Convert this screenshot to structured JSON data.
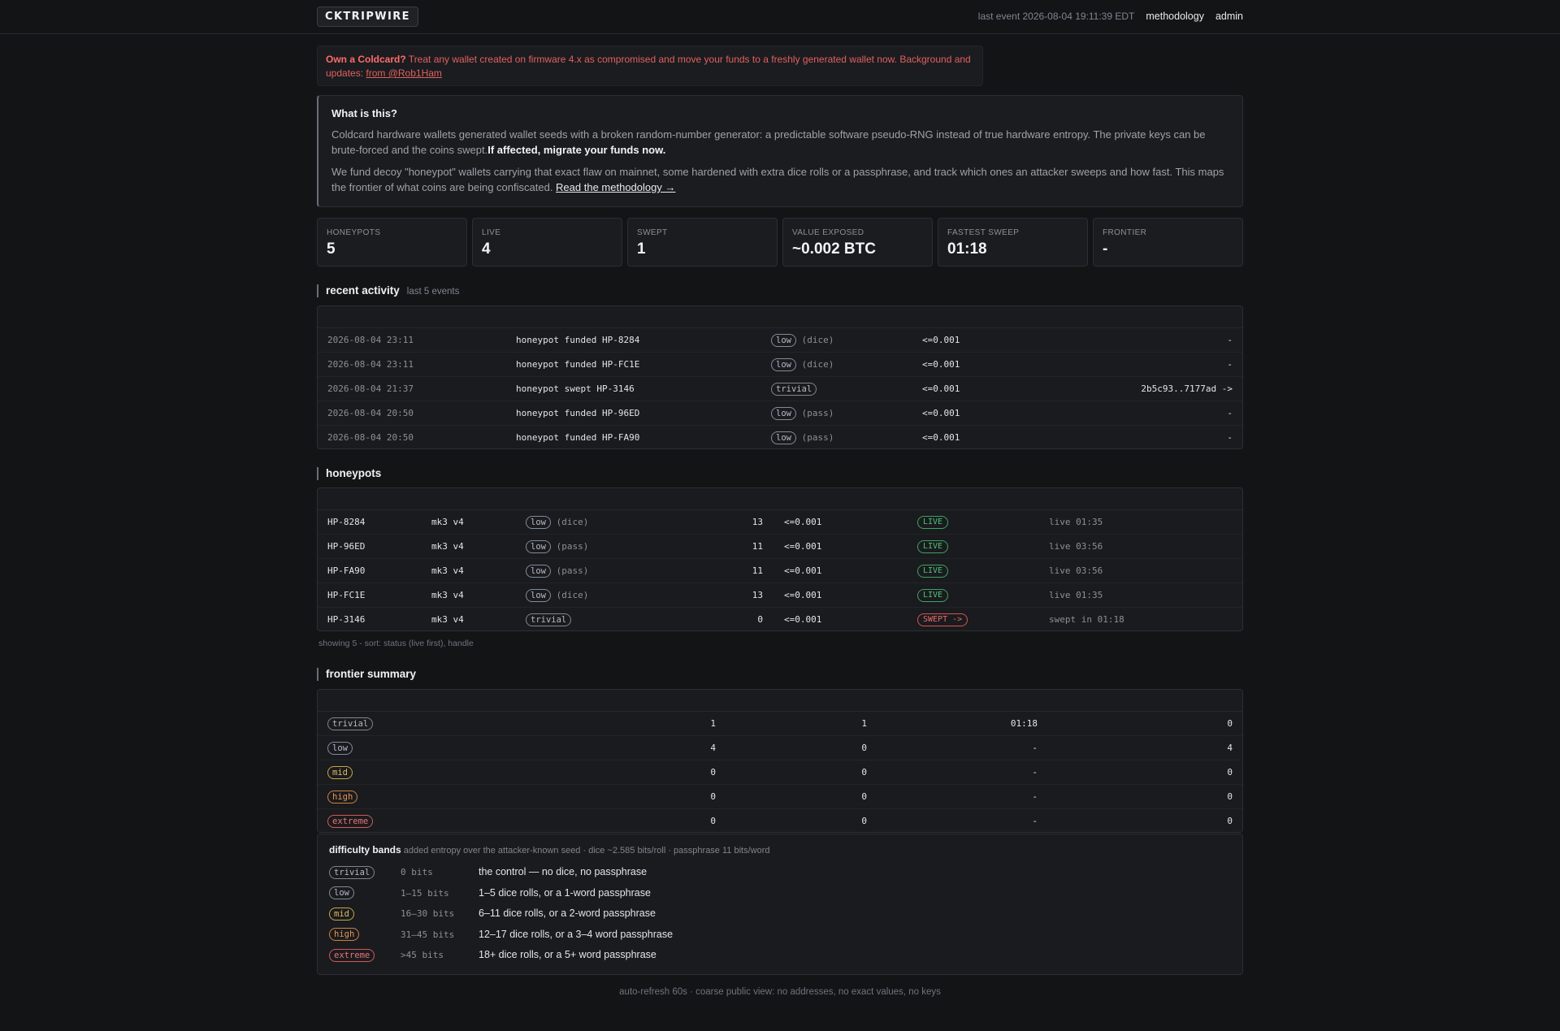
{
  "header": {
    "logo": "CKTRIPWIRE",
    "last_event": "last event 2026-08-04 19:11:39 EDT",
    "nav": [
      "methodology",
      "admin"
    ]
  },
  "alert": {
    "strong": "Own a Coldcard?",
    "text": " Treat any wallet created on firmware 4.x as compromised and move your funds to a freshly generated wallet now. Background and updates: ",
    "link": "from @Rob1Ham"
  },
  "about": {
    "title": "What is this?",
    "p1": "Coldcard hardware wallets generated wallet seeds with a broken random-number generator: a predictable software pseudo-RNG instead of true hardware entropy. The private keys can be brute-forced and the coins swept.",
    "p1_bold": "If affected, migrate your funds now.",
    "p2": "We fund decoy \"honeypot\" wallets carrying that exact flaw on mainnet, some hardened with extra dice rolls or a passphrase, and track which ones an attacker sweeps and how fast. This maps the frontier of what coins are being confiscated. ",
    "p2_link": "Read the methodology →"
  },
  "stats": [
    {
      "label": "HONEYPOTS",
      "value": "5"
    },
    {
      "label": "LIVE",
      "value": "4"
    },
    {
      "label": "SWEPT",
      "value": "1"
    },
    {
      "label": "VALUE EXPOSED",
      "value": "~0.002 BTC"
    },
    {
      "label": "FASTEST SWEEP",
      "value": "01:18"
    },
    {
      "label": "FRONTIER",
      "value": "-"
    }
  ],
  "activity": {
    "title": "recent activity",
    "subtitle": "last 5 events",
    "rows": [
      {
        "time": "2026-08-04 23:11",
        "event": "honeypot funded HP-8284",
        "band": "low",
        "hardening": "(dice)",
        "value": "<=0.001",
        "tx": "-"
      },
      {
        "time": "2026-08-04 23:11",
        "event": "honeypot funded HP-FC1E",
        "band": "low",
        "hardening": "(dice)",
        "value": "<=0.001",
        "tx": "-"
      },
      {
        "time": "2026-08-04 21:37",
        "event": "honeypot swept HP-3146",
        "band": "trivial",
        "hardening": "",
        "value": "<=0.001",
        "tx": "2b5c93..7177ad ->"
      },
      {
        "time": "2026-08-04 20:50",
        "event": "honeypot funded HP-96ED",
        "band": "low",
        "hardening": "(pass)",
        "value": "<=0.001",
        "tx": "-"
      },
      {
        "time": "2026-08-04 20:50",
        "event": "honeypot funded HP-FA90",
        "band": "low",
        "hardening": "(pass)",
        "value": "<=0.001",
        "tx": "-"
      }
    ]
  },
  "honeypots": {
    "title": "honeypots",
    "rows": [
      {
        "handle": "HP-8284",
        "device": "mk3 v4",
        "band": "low",
        "hardening": "(dice)",
        "bits": "13",
        "value": "<=0.001",
        "status": "LIVE",
        "kind": "live",
        "age": "live 01:35"
      },
      {
        "handle": "HP-96ED",
        "device": "mk3 v4",
        "band": "low",
        "hardening": "(pass)",
        "bits": "11",
        "value": "<=0.001",
        "status": "LIVE",
        "kind": "live",
        "age": "live 03:56"
      },
      {
        "handle": "HP-FA90",
        "device": "mk3 v4",
        "band": "low",
        "hardening": "(pass)",
        "bits": "11",
        "value": "<=0.001",
        "status": "LIVE",
        "kind": "live",
        "age": "live 03:56"
      },
      {
        "handle": "HP-FC1E",
        "device": "mk3 v4",
        "band": "low",
        "hardening": "(dice)",
        "bits": "13",
        "value": "<=0.001",
        "status": "LIVE",
        "kind": "live",
        "age": "live 01:35"
      },
      {
        "handle": "HP-3146",
        "device": "mk3 v4",
        "band": "trivial",
        "hardening": "",
        "bits": "0",
        "value": "<=0.001",
        "status": "SWEPT ->",
        "kind": "swept",
        "age": "swept in 01:18"
      }
    ],
    "caption": "showing 5 - sort: status (live first), handle"
  },
  "frontier": {
    "title": "frontier summary",
    "rows": [
      {
        "band": "trivial",
        "total": "1",
        "swept": "1",
        "fastest": "01:18",
        "live": "0"
      },
      {
        "band": "low",
        "total": "4",
        "swept": "0",
        "fastest": "-",
        "live": "4"
      },
      {
        "band": "mid",
        "total": "0",
        "swept": "0",
        "fastest": "-",
        "live": "0"
      },
      {
        "band": "high",
        "total": "0",
        "swept": "0",
        "fastest": "-",
        "live": "0"
      },
      {
        "band": "extreme",
        "total": "0",
        "swept": "0",
        "fastest": "-",
        "live": "0"
      }
    ]
  },
  "bands": {
    "title": "difficulty bands",
    "subtitle": "added entropy over the attacker-known seed · dice ~2.585 bits/roll · passphrase 11 bits/word",
    "rows": [
      {
        "band": "trivial",
        "bits": "0 bits",
        "desc": "the control — no dice, no passphrase"
      },
      {
        "band": "low",
        "bits": "1–15 bits",
        "desc": "1–5 dice rolls, or a 1-word passphrase"
      },
      {
        "band": "mid",
        "bits": "16–30 bits",
        "desc": "6–11 dice rolls, or a 2-word passphrase"
      },
      {
        "band": "high",
        "bits": "31–45 bits",
        "desc": "12–17 dice rolls, or a 3–4 word passphrase"
      },
      {
        "band": "extreme",
        "bits": ">45 bits",
        "desc": "18+ dice rolls, or a 5+ word passphrase"
      }
    ]
  },
  "footer": "auto-refresh 60s · coarse public view: no addresses, no exact values, no keys"
}
